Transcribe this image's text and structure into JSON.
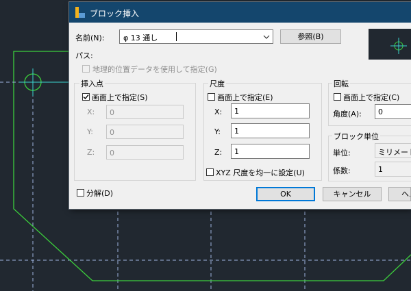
{
  "dialog": {
    "title": "ブロック挿入",
    "name_label": "名前(N):",
    "name_value": "φ 13 通し",
    "browse_button": "参照(B)",
    "path_label": "パス:",
    "geo_checkbox_label": "地理的位置データを使用して指定(G)",
    "insertion_point": {
      "title": "挿入点",
      "on_screen_label": "画面上で指定(S)",
      "on_screen_checked": true,
      "x_label": "X:",
      "y_label": "Y:",
      "z_label": "Z:",
      "x_value": "0",
      "y_value": "0",
      "z_value": "0"
    },
    "scale": {
      "title": "尺度",
      "on_screen_label": "画面上で指定(E)",
      "on_screen_checked": false,
      "x_label": "X:",
      "y_label": "Y:",
      "z_label": "Z:",
      "x_value": "1",
      "y_value": "1",
      "z_value": "1",
      "uniform_label": "XYZ 尺度を均一に設定(U)"
    },
    "rotation": {
      "title": "回転",
      "on_screen_label": "画面上で指定(C)",
      "angle_label": "角度(A):",
      "angle_value": "0"
    },
    "block_unit": {
      "title": "ブロック単位",
      "unit_label": "単位:",
      "unit_value": "ミリメートル",
      "factor_label": "係数:",
      "factor_value": "1"
    },
    "explode_label": "分解(D)",
    "ok_button": "OK",
    "cancel_button": "キャンセル",
    "help_button": "ヘルプ"
  },
  "colors": {
    "canvas": "#212830",
    "title_bar": "#14466d",
    "cad_green": "#3ccf3c",
    "cad_axis": "#9fb4e0"
  }
}
